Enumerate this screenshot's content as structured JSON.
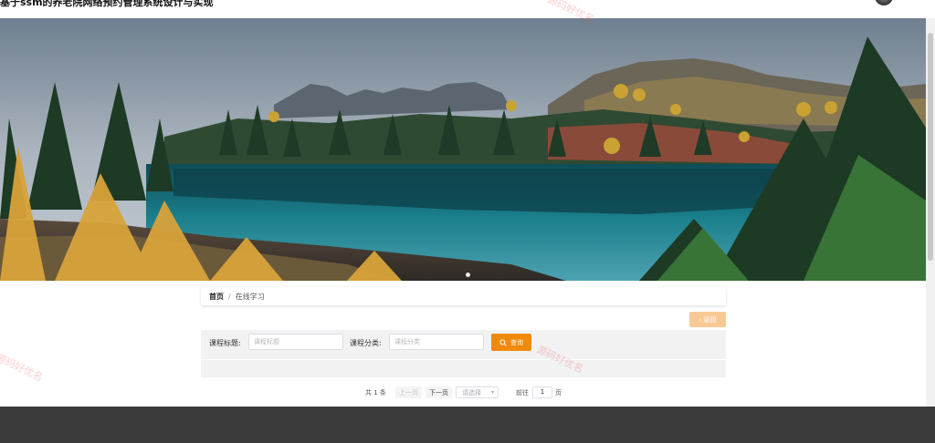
{
  "header": {
    "site_title": "基于ssm的养老院网络预约管理系统设计与实现"
  },
  "banner": {
    "image": "mountain lake landscape with autumn larch trees",
    "slides": 1,
    "active_slide": 1
  },
  "breadcrumb": {
    "home": "首页",
    "separator": "/",
    "current": "在线学习"
  },
  "toolbar": {
    "back_label": "返回"
  },
  "search": {
    "title_label": "课程标题:",
    "title_placeholder": "课程标题",
    "category_label": "课程分类:",
    "category_placeholder": "课程分类",
    "query_label": "查询"
  },
  "pagination": {
    "total_text": "共 1 条",
    "prev_label": "上一页",
    "next_label": "下一页",
    "page_size_placeholder": "请选择",
    "goto_label": "前往",
    "goto_value": "1",
    "page_unit": "页"
  },
  "watermarks": [
    "源码好优名",
    "源码好优名",
    "源码好优名"
  ],
  "colors": {
    "accent": "#f08a0c",
    "back_button": "#f9c995",
    "footer": "#3b3b3b",
    "panel": "#f2f2f2"
  }
}
